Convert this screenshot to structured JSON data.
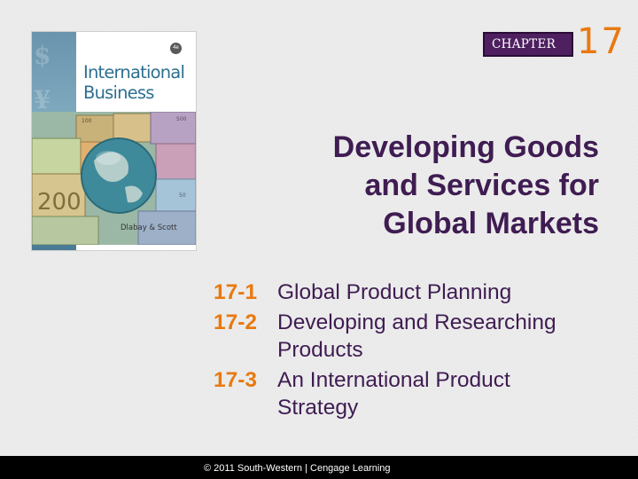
{
  "cover": {
    "title_line1": "International",
    "title_line2": "Business",
    "authors": "Dlabay & Scott",
    "edition_badge": "4e"
  },
  "chapter": {
    "label": "CHAPTER",
    "number": "17"
  },
  "title": {
    "line1": "Developing Goods",
    "line2": "and Services for",
    "line3": "Global Markets"
  },
  "objectives": [
    {
      "num": "17-1",
      "line1": "Global Product Planning",
      "line2": ""
    },
    {
      "num": "17-2",
      "line1": "Developing and Researching",
      "line2": "Products"
    },
    {
      "num": "17-3",
      "line1": "An International Product",
      "line2": "Strategy"
    }
  ],
  "footer": {
    "copyright": "© 2011 South-Western | Cengage Learning"
  },
  "colors": {
    "title": "#3f1c52",
    "accent_orange": "#e8790f",
    "chapter_box": "#4e2060",
    "footer_bg": "#000000"
  }
}
